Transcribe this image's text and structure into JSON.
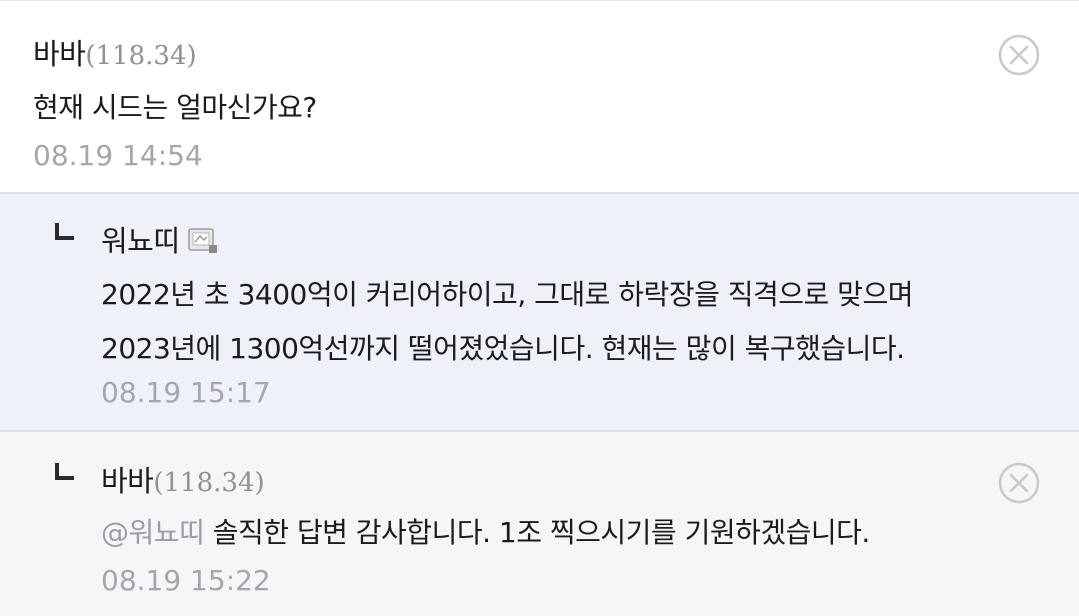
{
  "comments": [
    {
      "author": "바바",
      "ip": "(118.34)",
      "text": "현재 시드는 얼마신가요?",
      "time": "08.19 14:54",
      "icon": "close-circle-icon"
    },
    {
      "author": "워뇨띠",
      "line1": "2022년 초 3400억이 커리어하이고, 그대로 하락장을 직격으로 맞으며",
      "line2": "2023년에 1300억선까지 떨어졌었습니다. 현재는 많이 복구했습니다.",
      "time": "08.19 15:17",
      "icon": "user-badge-icon"
    },
    {
      "author": "바바",
      "ip": "(118.34)",
      "mention": "@워뇨띠",
      "text": "솔직한 답변 감사합니다. 1조 찍으시기를 기원하겠습니다.",
      "time": "08.19 15:22",
      "icon": "close-circle-icon"
    }
  ],
  "colors": {
    "reply_bg": "#eef1f7",
    "nested_bg": "#f5f6f8",
    "meta_gray": "#a3a6ab"
  }
}
